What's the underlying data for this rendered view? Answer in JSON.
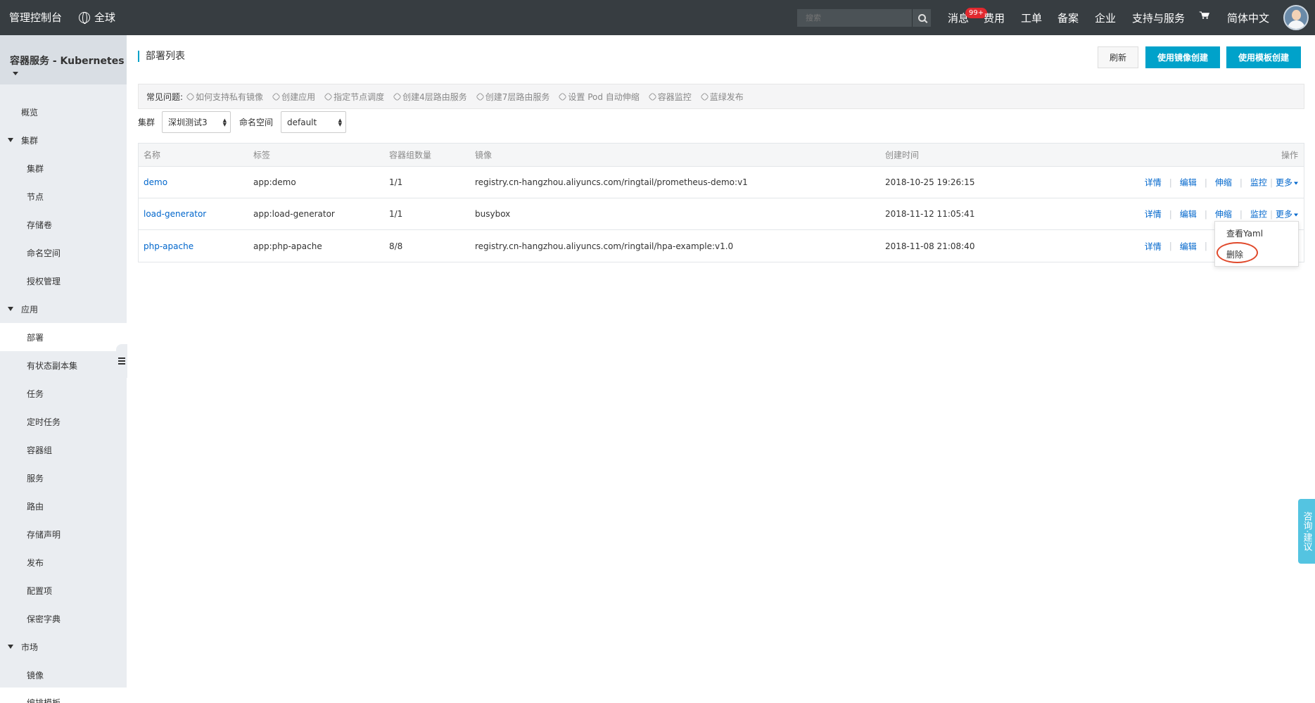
{
  "topbar": {
    "brand": "管理控制台",
    "region": "全球",
    "search_placeholder": "搜索",
    "nav": [
      "消息",
      "费用",
      "工单",
      "备案",
      "企业",
      "支持与服务",
      "简体中文"
    ],
    "message_badge": "99+"
  },
  "sidebar": {
    "title": "容器服务 - Kubernetes",
    "items": [
      {
        "label": "概览"
      },
      {
        "label": "集群"
      },
      {
        "label": "集群"
      },
      {
        "label": "节点"
      },
      {
        "label": "存储卷"
      },
      {
        "label": "命名空间"
      },
      {
        "label": "授权管理"
      },
      {
        "label": "应用"
      },
      {
        "label": "部署"
      },
      {
        "label": "有状态副本集"
      },
      {
        "label": "任务"
      },
      {
        "label": "定时任务"
      },
      {
        "label": "容器组"
      },
      {
        "label": "服务"
      },
      {
        "label": "路由"
      },
      {
        "label": "存储声明"
      },
      {
        "label": "发布"
      },
      {
        "label": "配置项"
      },
      {
        "label": "保密字典"
      },
      {
        "label": "市场"
      },
      {
        "label": "镜像"
      },
      {
        "label": "编排模板"
      }
    ]
  },
  "main": {
    "title": "部署列表",
    "buttons": {
      "refresh": "刷新",
      "create_image": "使用镜像创建",
      "create_template": "使用模板创建"
    },
    "faq": {
      "label": "常见问题:",
      "links": [
        "如何支持私有镜像",
        "创建应用",
        "指定节点调度",
        "创建4层路由服务",
        "创建7层路由服务",
        "设置 Pod 自动伸缩",
        "容器监控",
        "蓝绿发布"
      ]
    },
    "filters": {
      "cluster_label": "集群",
      "cluster_value": "深圳测试3",
      "namespace_label": "命名空间",
      "namespace_value": "default"
    },
    "table": {
      "headers": [
        "名称",
        "标签",
        "容器组数量",
        "镜像",
        "创建时间",
        "操作"
      ],
      "rows": [
        {
          "name": "demo",
          "label": "app:demo",
          "pods": "1/1",
          "image": "registry.cn-hangzhou.aliyuncs.com/ringtail/prometheus-demo:v1",
          "created": "2018-10-25 19:26:15"
        },
        {
          "name": "load-generator",
          "label": "app:load-generator",
          "pods": "1/1",
          "image": "busybox",
          "created": "2018-11-12 11:05:41"
        },
        {
          "name": "php-apache",
          "label": "app:php-apache",
          "pods": "8/8",
          "image": "registry.cn-hangzhou.aliyuncs.com/ringtail/hpa-example:v1.0",
          "created": "2018-11-08 21:08:40"
        }
      ],
      "actions": {
        "detail": "详情",
        "edit": "编辑",
        "scale": "伸缩",
        "monitor": "监控",
        "more": "更多"
      }
    },
    "dropdown": {
      "view_yaml": "查看Yaml",
      "delete": "删除"
    }
  },
  "feedback": "咨询·建议",
  "colors": {
    "topbar": "#373d41",
    "accent": "#00a2ca",
    "link": "#0066cc",
    "highlight": "#e0492b"
  }
}
